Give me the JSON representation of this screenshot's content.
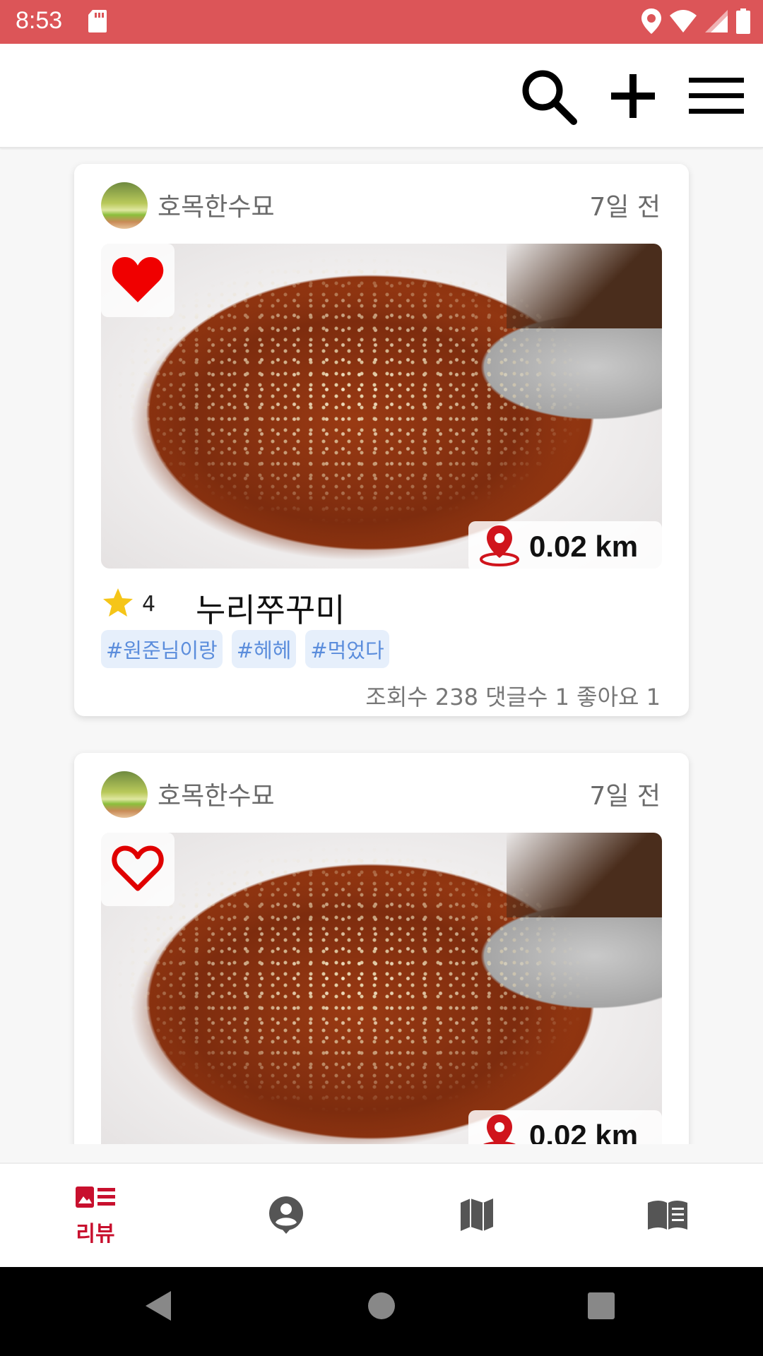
{
  "status_bar": {
    "time": "8:53"
  },
  "toolbar": {
    "search_icon": "search-icon",
    "add_icon": "plus-icon",
    "menu_icon": "menu-icon"
  },
  "posts": [
    {
      "author": "호목한수묘",
      "time_ago": "7일 전",
      "liked": true,
      "distance": "0.02 km",
      "rating": "4",
      "title": "누리쭈꾸미",
      "tags": [
        "#원준님이랑",
        "#헤헤",
        "#먹었다"
      ],
      "stats": "조회수 238  댓글수 1  좋아요 1"
    },
    {
      "author": "호목한수묘",
      "time_ago": "7일 전",
      "liked": false,
      "distance": "0.02 km"
    }
  ],
  "bottom_nav": {
    "items": [
      {
        "label": "리뷰",
        "icon": "review-list-icon",
        "active": true
      },
      {
        "label": "",
        "icon": "account-icon"
      },
      {
        "label": "",
        "icon": "map-icon"
      },
      {
        "label": "",
        "icon": "book-icon"
      }
    ]
  },
  "colors": {
    "status_bar": "#dc5558",
    "accent": "#c8102e",
    "tag_bg": "#e6effb",
    "tag_text": "#5b8ddc",
    "star": "#f5c518"
  }
}
